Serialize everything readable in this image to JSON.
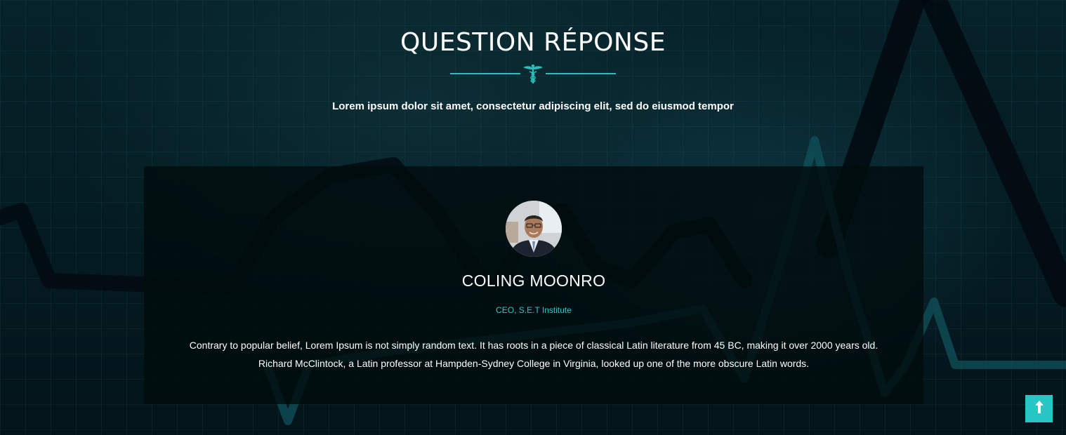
{
  "section": {
    "title": "QUESTION RÉPONSE",
    "divider_icon": "caduceus-icon",
    "subtitle": "Lorem ipsum dolor sit amet, consectetur adipiscing elit, sed do eiusmod tempor"
  },
  "testimonial": {
    "avatar_icon": "avatar",
    "name": "COLING MOONRO",
    "role": "CEO, S.E.T Institute",
    "quote": "Contrary to popular belief, Lorem Ipsum is not simply random text. It has roots in a piece of classical Latin literature from 45 BC, making it over 2000 years old. Richard McClintock, a Latin professor at Hampden-Sydney College in Virginia, looked up one of the more obscure Latin words."
  },
  "back_to_top": {
    "icon": "arrow-up-icon"
  },
  "colors": {
    "accent": "#26c6c4",
    "background": "#041a21",
    "card": "#010c0e"
  }
}
